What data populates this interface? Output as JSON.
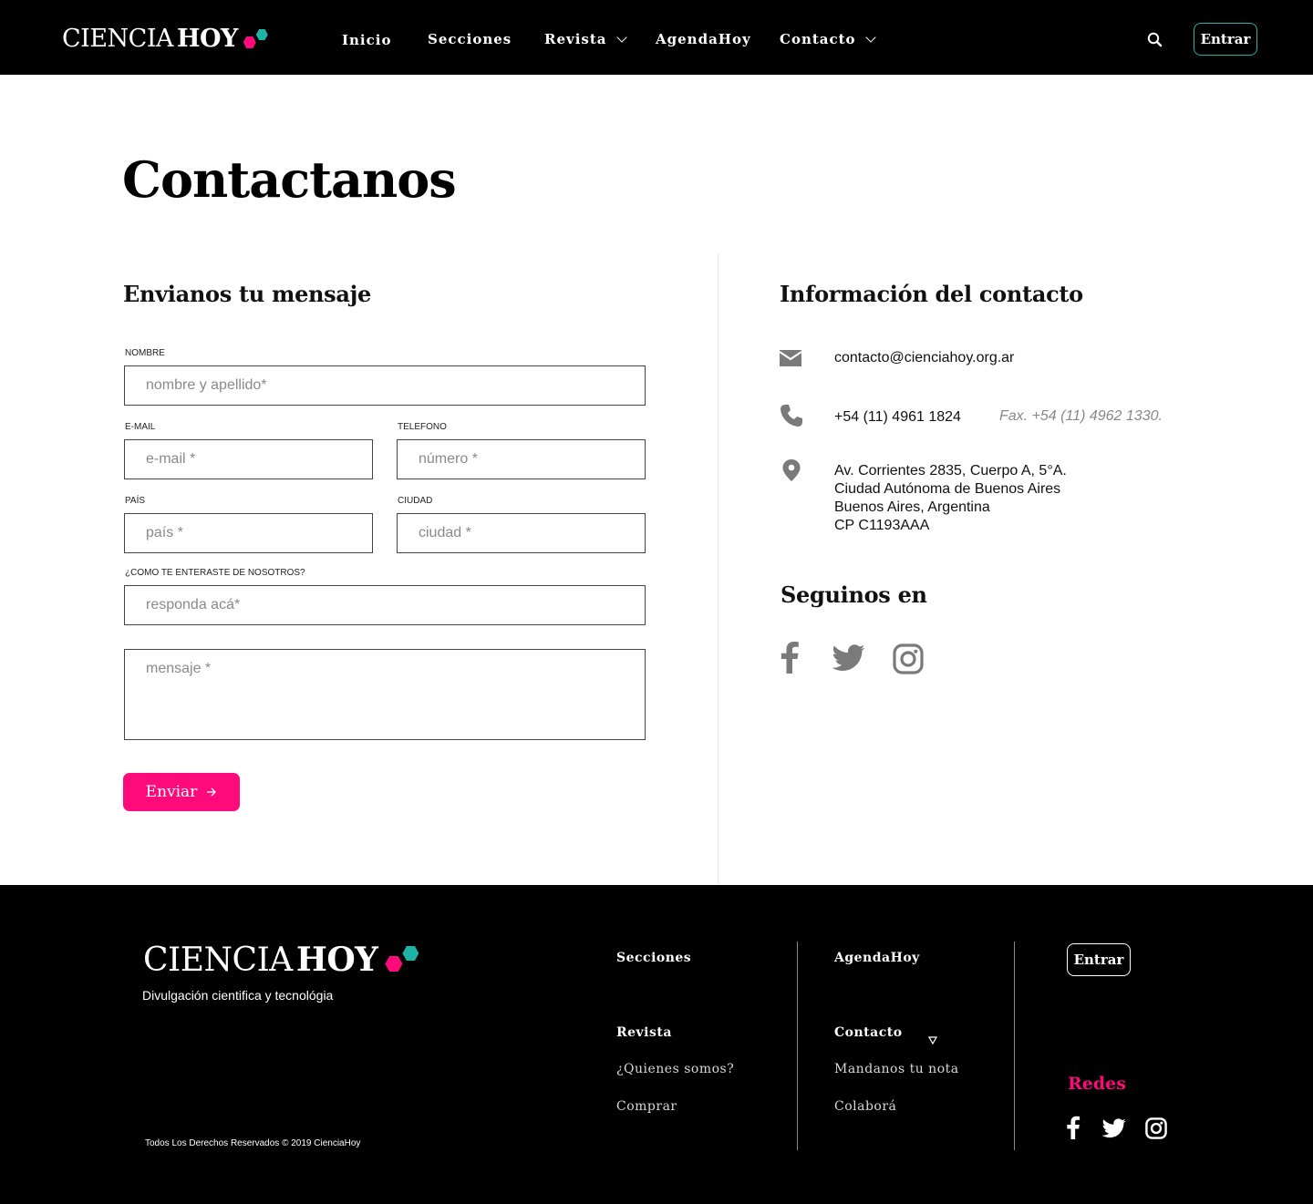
{
  "colors": {
    "accent_pink": "#ff0a7a",
    "accent_teal": "#1fb3a5",
    "header_bg": "#000000",
    "icon_gray": "#7a7a7a"
  },
  "brand": {
    "word1": "CIENCIA",
    "word2": "HOY"
  },
  "nav": {
    "items": [
      {
        "label": "Inicio",
        "has_dropdown": false
      },
      {
        "label": "Secciones",
        "has_dropdown": false
      },
      {
        "label": "Revista",
        "has_dropdown": true
      },
      {
        "label": "AgendaHoy",
        "has_dropdown": false
      },
      {
        "label": "Contacto",
        "has_dropdown": true
      }
    ],
    "search_icon": "search-icon",
    "login_label": "Entrar"
  },
  "main": {
    "title": "Contactanos",
    "form": {
      "heading": "Envianos tu mensaje",
      "nombre": {
        "label": "NOMBRE",
        "placeholder": "nombre y apellido*"
      },
      "email": {
        "label": "E-MAIL",
        "placeholder": "e-mail *"
      },
      "telefono": {
        "label": "TELEFONO",
        "placeholder": "número *"
      },
      "pais": {
        "label": "PAÍS",
        "placeholder": "país *"
      },
      "ciudad": {
        "label": "CIUDAD",
        "placeholder": "ciudad *"
      },
      "como": {
        "label": "¿COMO TE ENTERASTE DE NOSOTROS?",
        "placeholder": "responda acá*"
      },
      "mensaje": {
        "placeholder": "mensaje *"
      },
      "submit_label": "Enviar"
    },
    "info": {
      "heading": "Información del contacto",
      "email": "contacto@cienciahoy.org.ar",
      "phone": "+54 (11) 4961 1824",
      "fax": "Fax. +54 (11) 4962 1330.",
      "address": [
        "Av. Corrientes 2835, Cuerpo A, 5°A.",
        "Ciudad Autónoma de Buenos Aires",
        "Buenos Aires, Argentina",
        "CP C1193AAA"
      ],
      "social_heading": "Seguinos en",
      "social_icons": [
        "facebook-icon",
        "twitter-icon",
        "instagram-icon"
      ]
    }
  },
  "footer": {
    "tagline": "Divulgación cientifica y tecnológia",
    "copyright": "Todos Los Derechos Reservados © 2019 CienciaHoy",
    "col1": {
      "link1": "Secciones",
      "link2": "Revista",
      "link3": "¿Quienes somos?",
      "link4": "Comprar"
    },
    "col2": {
      "link1": "AgendaHoy",
      "link2": "Contacto",
      "link3": "Mandanos tu nota",
      "link4": "Colaborá"
    },
    "login_label": "Entrar",
    "redes_title": "Redes",
    "social_icons": [
      "facebook-icon",
      "twitter-icon",
      "instagram-icon"
    ]
  }
}
